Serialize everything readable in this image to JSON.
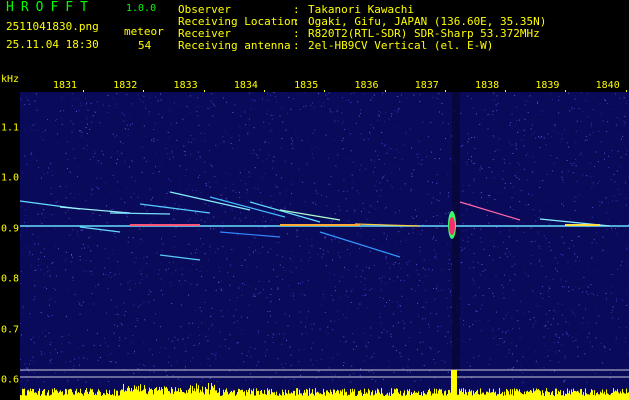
{
  "header": {
    "app_name": "HROFFT",
    "app_version": "1.0.0",
    "filename": "2511041830.png",
    "timestamp": "25.11.04 18:30",
    "type_label": "meteor",
    "count": "54",
    "info": [
      {
        "label": "Observer",
        "value": "Takanori Kawachi"
      },
      {
        "label": "Receiving Location",
        "value": "Ogaki, Gifu, JAPAN (136.60E, 35.35N)"
      },
      {
        "label": "Receiver",
        "value": "R820T2(RTL-SDR) SDR-Sharp 53.372MHz"
      },
      {
        "label": "Receiving antenna",
        "value": "2el-HB9CV Vertical (el. E-W)"
      }
    ]
  },
  "axes": {
    "freq_unit": "kHz",
    "time_labels": [
      "1831",
      "1832",
      "1833",
      "1834",
      "1835",
      "1836",
      "1837",
      "1838",
      "1839",
      "1840"
    ],
    "freq_labels": [
      "1.1",
      "1.0",
      "0.9",
      "0.8",
      "0.7",
      "0.6"
    ]
  },
  "colors": {
    "background": "#000000",
    "text_yellow": "#ffff00",
    "title_green": "#00ff00",
    "noise_blue": "#1a1a8c",
    "carrier_line": "#66ddff",
    "echo_hot": "#ff2a6d"
  }
}
